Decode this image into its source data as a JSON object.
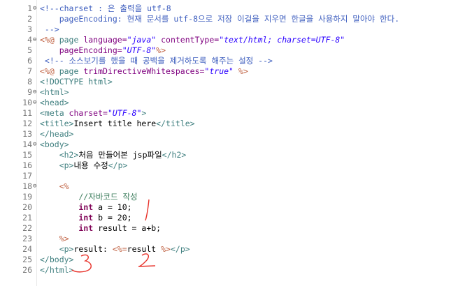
{
  "editor": {
    "lines": [
      {
        "n": "1",
        "fold": "⊖",
        "parts": [
          {
            "t": "<!--charset : 은 출력을 utf-8",
            "c": "cm"
          }
        ]
      },
      {
        "n": "2",
        "fold": "",
        "parts": [
          {
            "t": "    pageEncoding: 현재 문서를 utf-8으로 저장 이걸을 지우면 한글을 사용하지 말아야 한다.",
            "c": "cm"
          }
        ]
      },
      {
        "n": "3",
        "fold": "",
        "parts": [
          {
            "t": " -->",
            "c": "cm"
          }
        ]
      },
      {
        "n": "4",
        "fold": "⊖",
        "parts": [
          {
            "t": "<%@",
            "c": "dl"
          },
          {
            "t": " page ",
            "c": "tag"
          },
          {
            "t": "language=",
            "c": "attr"
          },
          {
            "t": "\"java\"",
            "c": "str"
          },
          {
            "t": " contentType=",
            "c": "attr"
          },
          {
            "t": "\"text/html; charset=UTF-8\"",
            "c": "str"
          }
        ]
      },
      {
        "n": "5",
        "fold": "",
        "parts": [
          {
            "t": "    pageEncoding=",
            "c": "attr"
          },
          {
            "t": "\"UTF-8\"",
            "c": "str"
          },
          {
            "t": "%>",
            "c": "dl"
          }
        ]
      },
      {
        "n": "6",
        "fold": "",
        "parts": [
          {
            "t": " <!-- 소스보기를 했을 때 공백을 제거하도록 해주는 설정 -->",
            "c": "cm"
          }
        ]
      },
      {
        "n": "7",
        "fold": "",
        "parts": [
          {
            "t": "<%@",
            "c": "dl"
          },
          {
            "t": " page ",
            "c": "tag"
          },
          {
            "t": "trimDirectiveWhitespaces=",
            "c": "attr"
          },
          {
            "t": "\"true\"",
            "c": "str"
          },
          {
            "t": " %>",
            "c": "dl"
          }
        ]
      },
      {
        "n": "8",
        "fold": "",
        "parts": [
          {
            "t": "<!DOCTYPE html>",
            "c": "tag"
          }
        ]
      },
      {
        "n": "9",
        "fold": "⊖",
        "parts": [
          {
            "t": "<html>",
            "c": "tag"
          }
        ]
      },
      {
        "n": "10",
        "fold": "⊖",
        "parts": [
          {
            "t": "<head>",
            "c": "tag"
          }
        ]
      },
      {
        "n": "11",
        "fold": "",
        "parts": [
          {
            "t": "<meta ",
            "c": "tag"
          },
          {
            "t": "charset=",
            "c": "attr"
          },
          {
            "t": "\"UTF-8\"",
            "c": "str"
          },
          {
            "t": ">",
            "c": "tag"
          }
        ]
      },
      {
        "n": "12",
        "fold": "",
        "parts": [
          {
            "t": "<title>",
            "c": "tag"
          },
          {
            "t": "Insert title here",
            "c": ""
          },
          {
            "t": "</title>",
            "c": "tag"
          }
        ]
      },
      {
        "n": "13",
        "fold": "",
        "parts": [
          {
            "t": "</head>",
            "c": "tag"
          }
        ]
      },
      {
        "n": "14",
        "fold": "⊖",
        "parts": [
          {
            "t": "<body>",
            "c": "tag"
          }
        ]
      },
      {
        "n": "15",
        "fold": "",
        "parts": [
          {
            "t": "    ",
            "c": ""
          },
          {
            "t": "<h2>",
            "c": "tag"
          },
          {
            "t": "처음 만들어본 jsp파일",
            "c": ""
          },
          {
            "t": "</h2>",
            "c": "tag"
          }
        ]
      },
      {
        "n": "16",
        "fold": "",
        "parts": [
          {
            "t": "    ",
            "c": ""
          },
          {
            "t": "<p>",
            "c": "tag"
          },
          {
            "t": "내용 수정",
            "c": ""
          },
          {
            "t": "</p>",
            "c": "tag"
          }
        ]
      },
      {
        "n": "17",
        "fold": "",
        "parts": []
      },
      {
        "n": "18",
        "fold": "⊖",
        "parts": [
          {
            "t": "    ",
            "c": ""
          },
          {
            "t": "<%",
            "c": "dl"
          }
        ]
      },
      {
        "n": "19",
        "fold": "",
        "parts": [
          {
            "t": "        //자바코드 작성",
            "c": "jc"
          }
        ]
      },
      {
        "n": "20",
        "fold": "",
        "parts": [
          {
            "t": "        ",
            "c": ""
          },
          {
            "t": "int",
            "c": "kw"
          },
          {
            "t": " a = 10;",
            "c": ""
          }
        ]
      },
      {
        "n": "21",
        "fold": "",
        "parts": [
          {
            "t": "        ",
            "c": ""
          },
          {
            "t": "int",
            "c": "kw"
          },
          {
            "t": " b = 20;",
            "c": ""
          }
        ]
      },
      {
        "n": "22",
        "fold": "",
        "parts": [
          {
            "t": "        ",
            "c": ""
          },
          {
            "t": "int",
            "c": "kw"
          },
          {
            "t": " result = a+b;",
            "c": ""
          }
        ]
      },
      {
        "n": "23",
        "fold": "",
        "parts": [
          {
            "t": "    ",
            "c": ""
          },
          {
            "t": "%>",
            "c": "dl"
          }
        ]
      },
      {
        "n": "24",
        "fold": "",
        "parts": [
          {
            "t": "    ",
            "c": ""
          },
          {
            "t": "<p>",
            "c": "tag"
          },
          {
            "t": "result: ",
            "c": ""
          },
          {
            "t": "<%=",
            "c": "dl"
          },
          {
            "t": "result ",
            "c": ""
          },
          {
            "t": "%>",
            "c": "dl"
          },
          {
            "t": "</p>",
            "c": "tag"
          }
        ]
      },
      {
        "n": "25",
        "fold": "",
        "parts": [
          {
            "t": "</body>",
            "c": "tag"
          }
        ]
      },
      {
        "n": "26",
        "fold": "",
        "parts": [
          {
            "t": "</html>",
            "c": "tag"
          }
        ]
      }
    ]
  },
  "annotations": {
    "color": "#e8322a",
    "marks": [
      "1",
      "2",
      "3"
    ]
  }
}
